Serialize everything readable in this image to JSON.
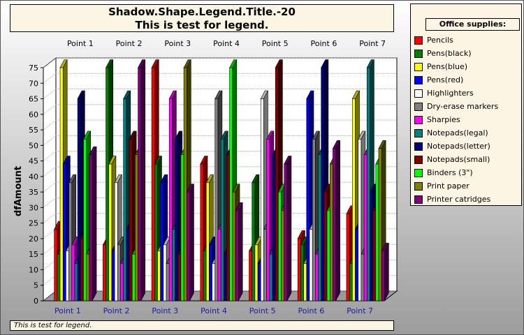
{
  "title": {
    "line1": "Shadow.Shape.Legend.Title.-20",
    "line2": "This is test for legend."
  },
  "footer": {
    "text": "This is test for legend."
  },
  "chart_data": {
    "type": "bar",
    "style": "3d-clustered",
    "ylabel": "dfAmount",
    "ylim": [
      0,
      75
    ],
    "ytick_step": 5,
    "grid": true,
    "legend_title": "Office supplies:",
    "legend_position": "right",
    "categories": [
      "Point 1",
      "Point 2",
      "Point 3",
      "Point 4",
      "Point 5",
      "Point 6",
      "Point 7"
    ],
    "series": [
      {
        "name": "Pencils",
        "color": "#ff0000",
        "values": [
          23,
          18,
          75,
          44,
          16,
          20,
          28
        ]
      },
      {
        "name": "Pens(black)",
        "color": "#008000",
        "values": [
          15,
          75,
          44,
          16,
          38,
          18,
          12
        ]
      },
      {
        "name": "Pens(blue)",
        "color": "#ffff00",
        "values": [
          75,
          44,
          16,
          38,
          18,
          12,
          65
        ]
      },
      {
        "name": "Pens(red)",
        "color": "#0000ff",
        "values": [
          44,
          16,
          38,
          18,
          12,
          65,
          23
        ]
      },
      {
        "name": "Highlighters",
        "color": "#ffffff",
        "values": [
          16,
          38,
          18,
          12,
          65,
          23,
          52
        ]
      },
      {
        "name": "Dry-erase markers",
        "color": "#808080",
        "values": [
          38,
          18,
          12,
          65,
          23,
          52,
          15
        ]
      },
      {
        "name": "Sharpies",
        "color": "#ff00ff",
        "values": [
          18,
          12,
          65,
          23,
          52,
          15,
          47
        ]
      },
      {
        "name": "Notepads(legal)",
        "color": "#008080",
        "values": [
          12,
          65,
          23,
          52,
          15,
          47,
          75
        ]
      },
      {
        "name": "Notepads(letter)",
        "color": "#000080",
        "values": [
          65,
          23,
          52,
          15,
          47,
          75,
          35
        ]
      },
      {
        "name": "Notepads(small)",
        "color": "#800000",
        "values": [
          20,
          52,
          15,
          47,
          75,
          35,
          29
        ]
      },
      {
        "name": "Binders (3\")",
        "color": "#00ff00",
        "values": [
          52,
          15,
          47,
          75,
          35,
          29,
          44
        ]
      },
      {
        "name": "Print paper",
        "color": "#808000",
        "values": [
          15,
          47,
          75,
          35,
          29,
          44,
          49
        ]
      },
      {
        "name": "Printer catridges",
        "color": "#800080",
        "values": [
          47,
          75,
          35,
          29,
          44,
          49,
          16
        ]
      }
    ]
  }
}
